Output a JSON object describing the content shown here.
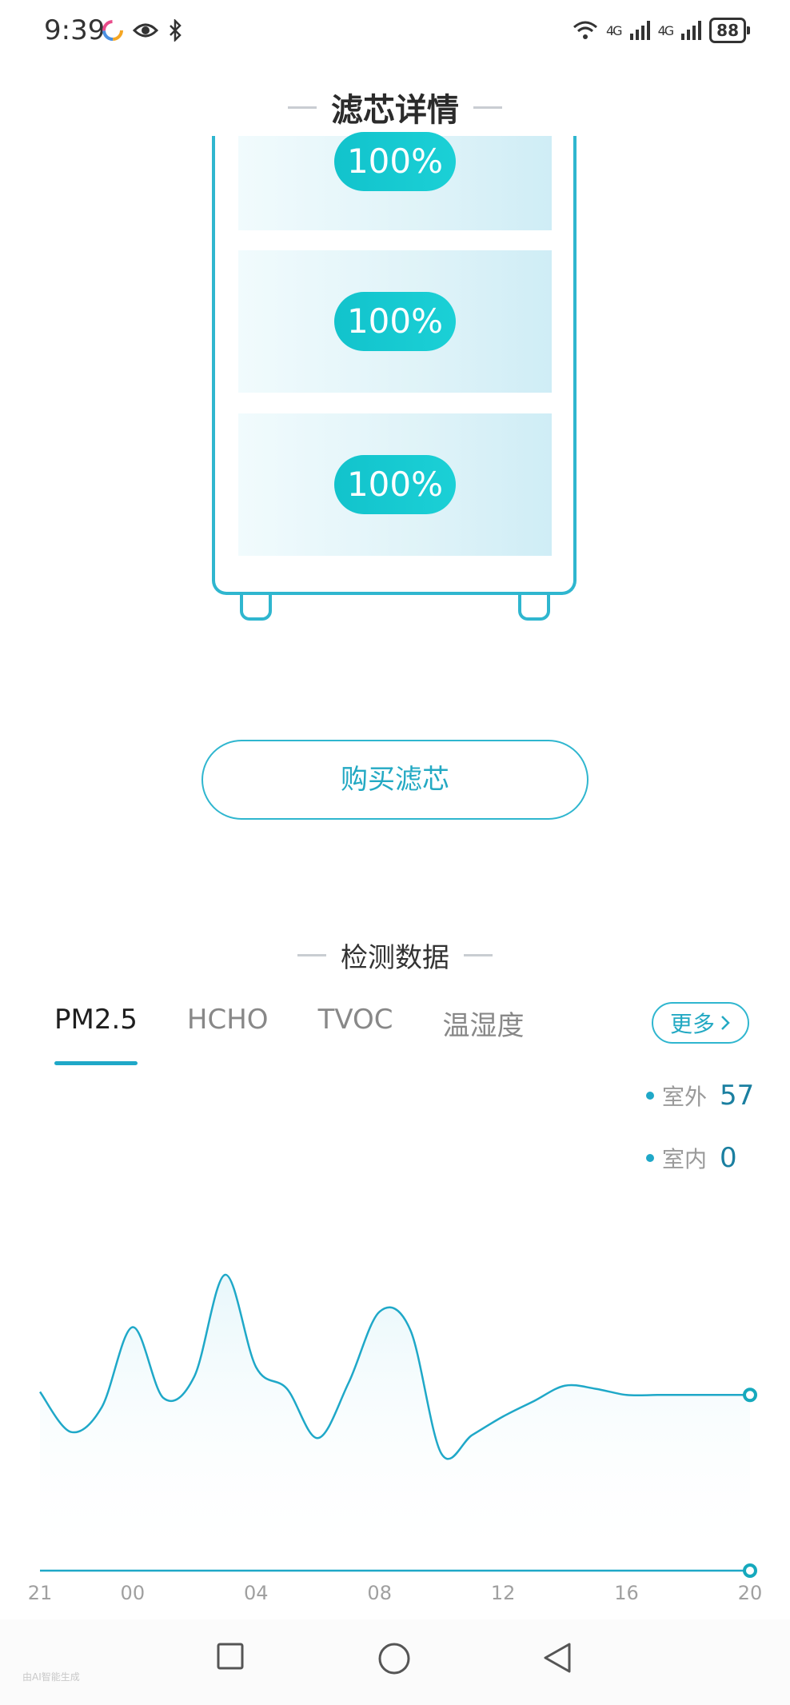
{
  "status_bar": {
    "time": "9:39",
    "network_left": "4G",
    "network_right": "4G",
    "battery": "88"
  },
  "header": {
    "title": "滤芯详情"
  },
  "filters": [
    {
      "percent": "100%"
    },
    {
      "percent": "100%"
    },
    {
      "percent": "100%"
    }
  ],
  "buy_button": {
    "label": "购买滤芯"
  },
  "detect": {
    "title": "检测数据",
    "tabs": [
      {
        "label": "PM2.5",
        "active": true
      },
      {
        "label": "HCHO",
        "active": false
      },
      {
        "label": "TVOC",
        "active": false
      },
      {
        "label": "温湿度",
        "active": false
      }
    ],
    "more_label": "更多"
  },
  "legend": {
    "outdoor_label": "室外",
    "outdoor_value": "57",
    "indoor_label": "室内",
    "indoor_value": "0"
  },
  "chart_data": {
    "type": "line",
    "x": [
      "21",
      "22",
      "23",
      "00",
      "01",
      "02",
      "03",
      "04",
      "05",
      "06",
      "07",
      "08",
      "09",
      "10",
      "11",
      "12",
      "13",
      "14",
      "15",
      "16",
      "17",
      "18",
      "19",
      "20"
    ],
    "tick_labels": [
      "21",
      "00",
      "04",
      "08",
      "12",
      "16",
      "20"
    ],
    "series": [
      {
        "name": "室外",
        "values": [
          58,
          45,
          53,
          79,
          56,
          63,
          96,
          66,
          59,
          43,
          61,
          84,
          78,
          38,
          44,
          50,
          55,
          60,
          59,
          57,
          57,
          57,
          57,
          57
        ]
      },
      {
        "name": "室内",
        "values": [
          0,
          0,
          0,
          0,
          0,
          0,
          0,
          0,
          0,
          0,
          0,
          0,
          0,
          0,
          0,
          0,
          0,
          0,
          0,
          0,
          0,
          0,
          0,
          0
        ]
      }
    ],
    "ylim": [
      0,
      110
    ],
    "colors": {
      "line": "#1fa8c8",
      "fill": "#eef9fc"
    }
  },
  "watermark": "由AI智能生成"
}
